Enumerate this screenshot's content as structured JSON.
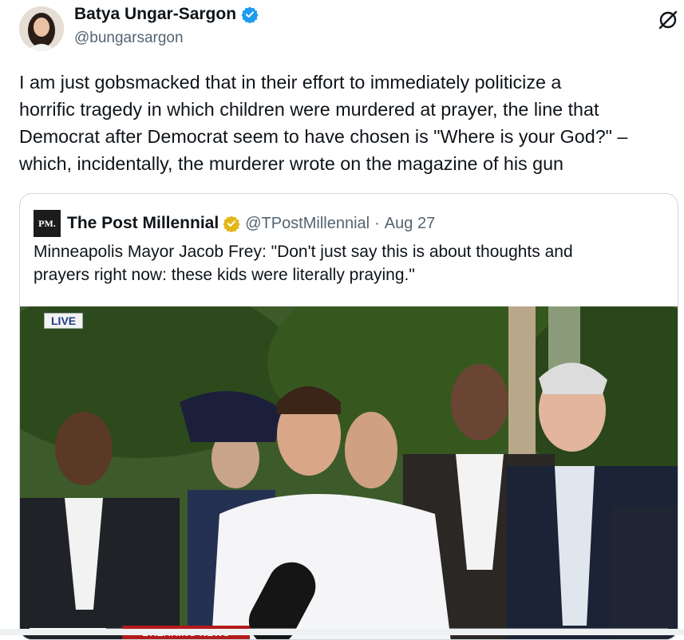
{
  "author": {
    "name": "Batya Ungar-Sargon",
    "handle": "@bungarsargon",
    "verified_color": "#1d9bf0"
  },
  "tweet": {
    "lines": [
      "I am just gobsmacked that in their effort to immediately politicize a",
      "horrific tragedy in which children were murdered at prayer, the line that",
      "Democrat after Democrat seem to have chosen is \"Where is your God?\" –",
      "which, incidentally, the murderer wrote on the magazine of his gun"
    ]
  },
  "quote": {
    "logo_text": "PM.",
    "name": "The Post Millennial",
    "badge_color": "#e2b719",
    "handle": "@TPostMillennial",
    "separator": "·",
    "date": "Aug 27",
    "lines": [
      "Minneapolis Mayor Jacob Frey: \"Don't just say this is about thoughts and",
      "prayers right now: these kids were literally praying.\""
    ],
    "video": {
      "live_label": "LIVE",
      "breaking_label": "BREAKING NEWS",
      "progress": 0.12
    }
  },
  "icons": {
    "grok": "grok-icon",
    "verified": "verified-badge-icon",
    "gold_badge": "gold-verified-badge-icon"
  }
}
